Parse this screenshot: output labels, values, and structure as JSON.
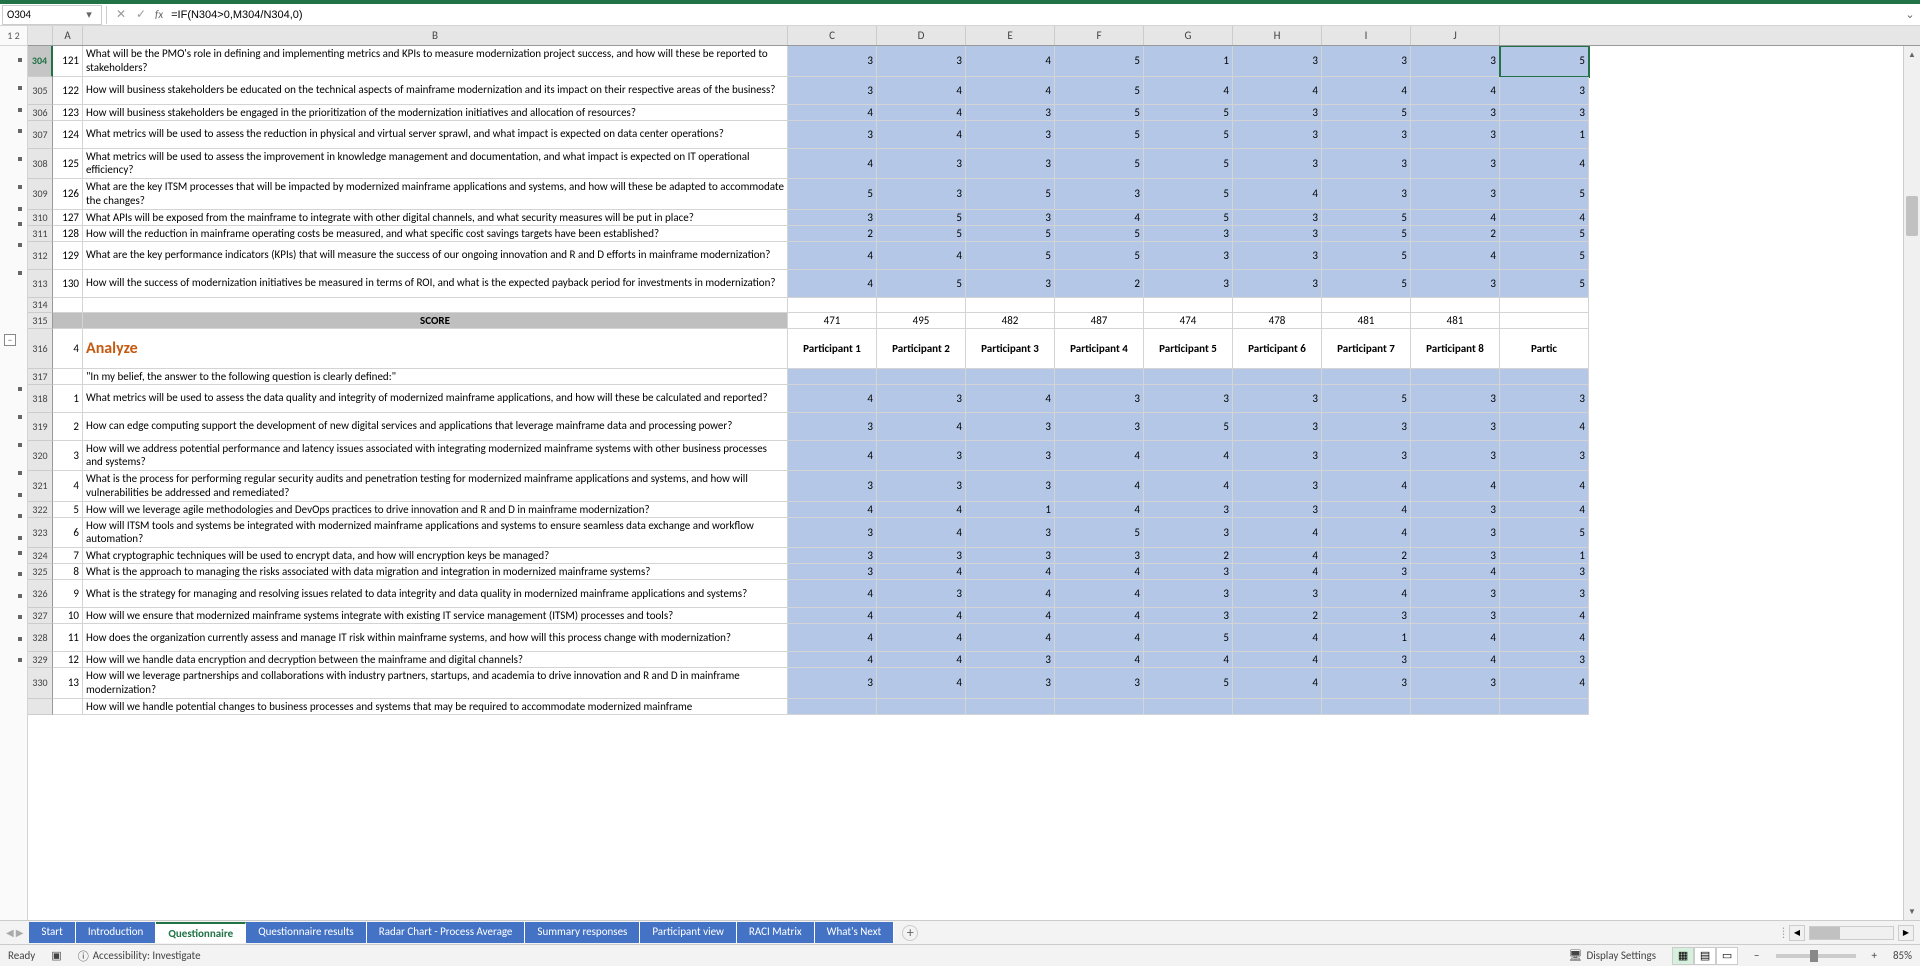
{
  "name_box": "O304",
  "formula": "=IF(N304>0,M304/N304,0)",
  "outline_labels": [
    "1",
    "2"
  ],
  "columns": [
    "A",
    "B",
    "C",
    "D",
    "E",
    "F",
    "G",
    "H",
    "I",
    "J"
  ],
  "rows_top": [
    {
      "rn": "304",
      "a": "121",
      "b": "What will be the PMO's role in defining and implementing metrics and KPIs to measure modernization project success, and how will these be reported to stakeholders?",
      "vals": [
        "3",
        "3",
        "4",
        "5",
        "1",
        "3",
        "3",
        "3",
        "5"
      ],
      "tall": true
    },
    {
      "rn": "305",
      "a": "122",
      "b": "How will business stakeholders be educated on the technical aspects of mainframe modernization and its impact on their respective areas of the business?",
      "vals": [
        "3",
        "4",
        "4",
        "5",
        "4",
        "4",
        "4",
        "4",
        "3"
      ],
      "tall": true
    },
    {
      "rn": "306",
      "a": "123",
      "b": "How will business stakeholders be engaged in the prioritization of the modernization initiatives and allocation of resources?",
      "vals": [
        "4",
        "4",
        "3",
        "5",
        "5",
        "3",
        "5",
        "3",
        "3"
      ]
    },
    {
      "rn": "307",
      "a": "124",
      "b": "What metrics will be used to assess the reduction in physical and virtual server sprawl, and what impact is expected on data center operations?",
      "vals": [
        "3",
        "4",
        "3",
        "5",
        "5",
        "3",
        "3",
        "3",
        "1"
      ],
      "tall": true
    },
    {
      "rn": "308",
      "a": "125",
      "b": "What metrics will be used to assess the improvement in knowledge management and documentation, and what impact is expected on IT operational efficiency?",
      "vals": [
        "4",
        "3",
        "3",
        "5",
        "5",
        "3",
        "3",
        "3",
        "4"
      ],
      "tall": true
    },
    {
      "rn": "309",
      "a": "126",
      "b": "What are the key ITSM processes that will be impacted by modernized mainframe applications and systems, and how will these be adapted to accommodate the changes?",
      "vals": [
        "5",
        "3",
        "5",
        "3",
        "5",
        "4",
        "3",
        "3",
        "5"
      ],
      "tall": true
    },
    {
      "rn": "310",
      "a": "127",
      "b": "What APIs will be exposed from the mainframe to integrate with other digital channels, and what security measures will be put in place?",
      "vals": [
        "3",
        "5",
        "3",
        "4",
        "5",
        "3",
        "5",
        "4",
        "4"
      ]
    },
    {
      "rn": "311",
      "a": "128",
      "b": "How will the reduction in mainframe operating costs be measured, and what specific cost savings targets have been established?",
      "vals": [
        "2",
        "5",
        "5",
        "5",
        "3",
        "3",
        "5",
        "2",
        "5"
      ]
    },
    {
      "rn": "312",
      "a": "129",
      "b": "What are the key performance indicators (KPIs) that will measure the success of our ongoing innovation and R and D efforts in mainframe modernization?",
      "vals": [
        "4",
        "4",
        "5",
        "5",
        "3",
        "3",
        "5",
        "4",
        "5"
      ],
      "tall": true
    },
    {
      "rn": "313",
      "a": "130",
      "b": "How will the success of modernization initiatives be measured in terms of ROI, and what is the expected payback period for investments in modernization?",
      "vals": [
        "4",
        "5",
        "3",
        "2",
        "3",
        "3",
        "5",
        "3",
        "5"
      ],
      "tall": true
    }
  ],
  "row314": {
    "rn": "314"
  },
  "score_row": {
    "rn": "315",
    "label": "SCORE",
    "vals": [
      "471",
      "495",
      "482",
      "487",
      "474",
      "478",
      "481",
      "481",
      ""
    ]
  },
  "section_row": {
    "rn": "316",
    "a": "4",
    "title": "Analyze",
    "participants": [
      "Participant 1",
      "Participant 2",
      "Participant 3",
      "Participant 4",
      "Participant 5",
      "Participant 6",
      "Participant 7",
      "Participant 8",
      "Partic"
    ]
  },
  "quote_row": {
    "rn": "317",
    "text": "\"In my belief, the answer to the following question is clearly defined:\""
  },
  "rows_bottom": [
    {
      "rn": "318",
      "a": "1",
      "b": "What metrics will be used to assess the data quality and integrity of modernized mainframe applications, and how will these be calculated and reported?",
      "vals": [
        "4",
        "3",
        "4",
        "3",
        "3",
        "3",
        "5",
        "3",
        "3"
      ],
      "tall": true
    },
    {
      "rn": "319",
      "a": "2",
      "b": "How can edge computing support the development of new digital services and applications that leverage mainframe data and processing power?",
      "vals": [
        "3",
        "4",
        "3",
        "3",
        "5",
        "3",
        "3",
        "3",
        "4"
      ],
      "tall": true
    },
    {
      "rn": "320",
      "a": "3",
      "b": "How will we address potential performance and latency issues associated with integrating modernized mainframe systems with other business processes and systems?",
      "vals": [
        "4",
        "3",
        "3",
        "4",
        "4",
        "3",
        "3",
        "3",
        "3"
      ],
      "tall": true
    },
    {
      "rn": "321",
      "a": "4",
      "b": "What is the process for performing regular security audits and penetration testing for modernized mainframe applications and systems, and how will vulnerabilities be addressed and remediated?",
      "vals": [
        "3",
        "3",
        "3",
        "4",
        "4",
        "3",
        "4",
        "4",
        "4"
      ],
      "tall": true
    },
    {
      "rn": "322",
      "a": "5",
      "b": "How will we leverage agile methodologies and DevOps practices to drive innovation and R and D in mainframe modernization?",
      "vals": [
        "4",
        "4",
        "1",
        "4",
        "3",
        "3",
        "4",
        "3",
        "4"
      ]
    },
    {
      "rn": "323",
      "a": "6",
      "b": "How will ITSM tools and systems be integrated with modernized mainframe applications and systems to ensure seamless data exchange and workflow automation?",
      "vals": [
        "3",
        "4",
        "3",
        "5",
        "3",
        "4",
        "4",
        "3",
        "5"
      ],
      "tall": true
    },
    {
      "rn": "324",
      "a": "7",
      "b": "What cryptographic techniques will be used to encrypt data, and how will encryption keys be managed?",
      "vals": [
        "3",
        "3",
        "3",
        "3",
        "2",
        "4",
        "2",
        "3",
        "1"
      ]
    },
    {
      "rn": "325",
      "a": "8",
      "b": "What is the approach to managing the risks associated with data migration and integration in modernized mainframe systems?",
      "vals": [
        "3",
        "4",
        "4",
        "4",
        "3",
        "4",
        "3",
        "4",
        "3"
      ]
    },
    {
      "rn": "326",
      "a": "9",
      "b": "What is the strategy for managing and resolving issues related to data integrity and data quality in modernized mainframe applications and systems?",
      "vals": [
        "4",
        "3",
        "4",
        "4",
        "3",
        "3",
        "4",
        "3",
        "3"
      ],
      "tall": true
    },
    {
      "rn": "327",
      "a": "10",
      "b": "How will we ensure that modernized mainframe systems integrate with existing IT service management (ITSM) processes and tools?",
      "vals": [
        "4",
        "4",
        "4",
        "4",
        "3",
        "2",
        "3",
        "3",
        "4"
      ]
    },
    {
      "rn": "328",
      "a": "11",
      "b": "How does the organization currently assess and manage IT risk within mainframe systems, and how will this process change with modernization?",
      "vals": [
        "4",
        "4",
        "4",
        "4",
        "5",
        "4",
        "1",
        "4",
        "4"
      ],
      "tall": true
    },
    {
      "rn": "329",
      "a": "12",
      "b": "How will we handle data encryption and decryption between the mainframe and digital channels?",
      "vals": [
        "4",
        "4",
        "3",
        "4",
        "4",
        "4",
        "3",
        "4",
        "3"
      ]
    },
    {
      "rn": "330",
      "a": "13",
      "b": "How will we leverage partnerships and collaborations with industry partners, startups, and academia to drive innovation and R and D in mainframe modernization?",
      "vals": [
        "3",
        "4",
        "3",
        "3",
        "5",
        "4",
        "3",
        "3",
        "4"
      ],
      "tall": true
    }
  ],
  "cut_row_text": "How will we handle potential changes to business processes and systems that may be required to accommodate modernized mainframe",
  "tabs": [
    "Start",
    "Introduction",
    "Questionnaire",
    "Questionnaire results",
    "Radar Chart - Process Average",
    "Summary responses",
    "Participant view",
    "RACI Matrix",
    "What's Next"
  ],
  "active_tab": 2,
  "status": {
    "ready": "Ready",
    "accessibility": "Accessibility: Investigate",
    "display": "Display Settings",
    "zoom": "85%"
  }
}
